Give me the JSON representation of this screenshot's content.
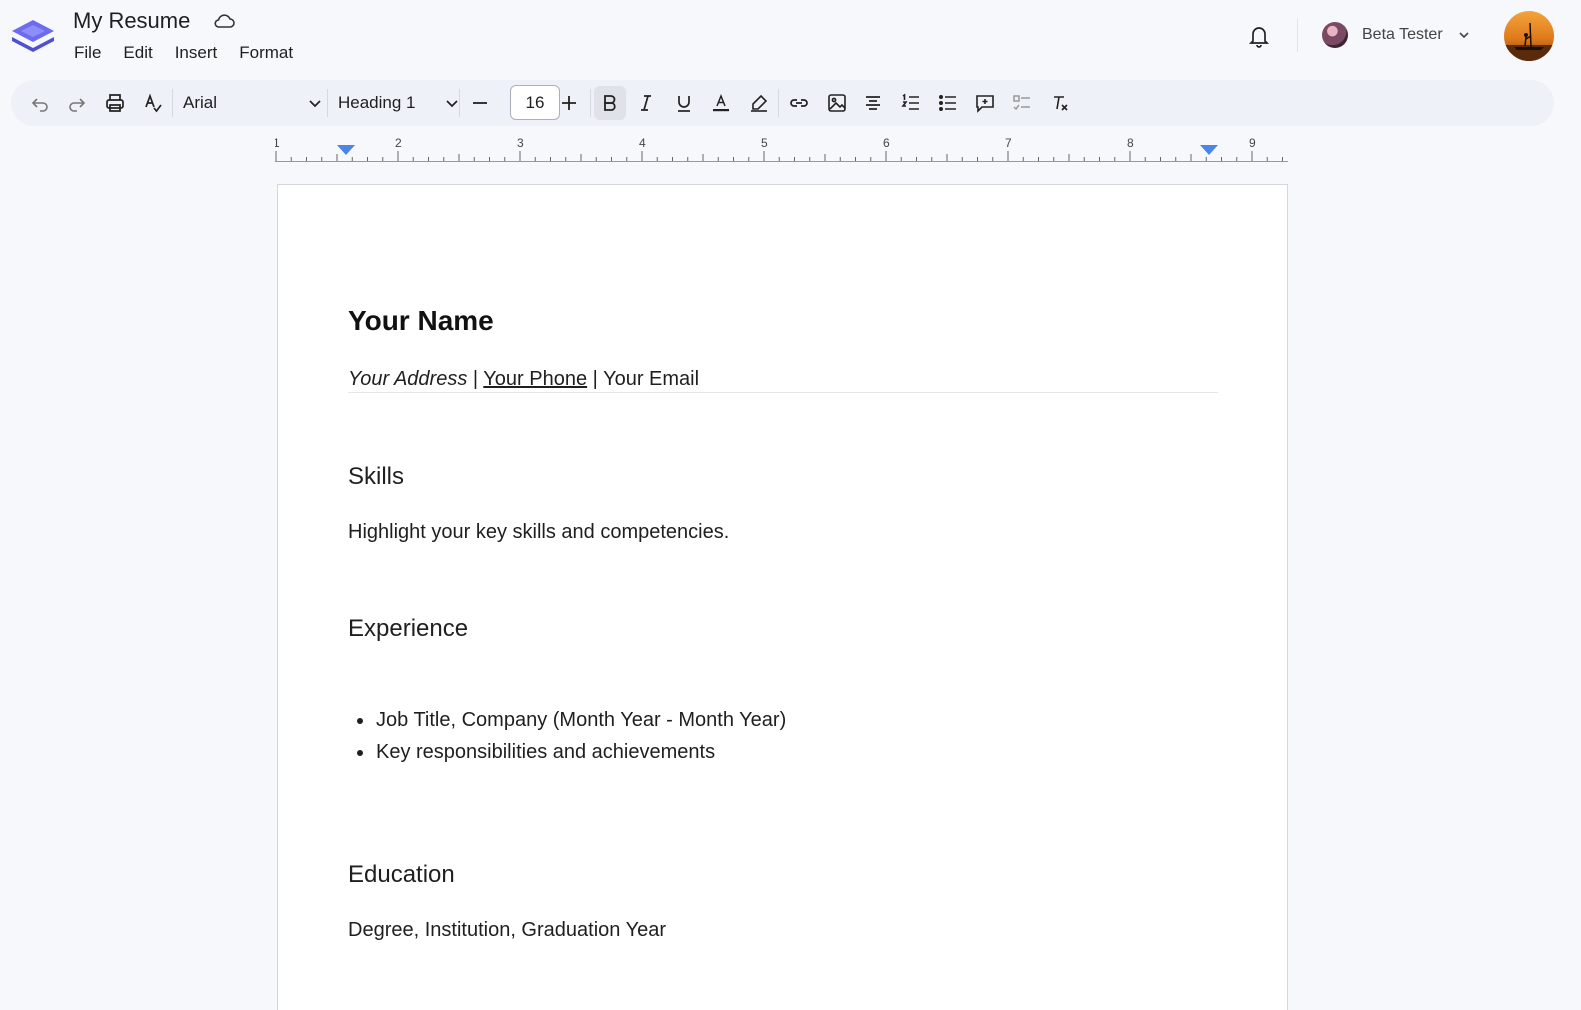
{
  "app": {
    "doc_title": "My Resume",
    "menu": [
      "File",
      "Edit",
      "Insert",
      "Format"
    ],
    "user_name": "Beta Tester",
    "accent_color": "#5b5bd6"
  },
  "toolbar": {
    "font": "Arial",
    "paragraph_style": "Heading 1",
    "font_size": "16"
  },
  "ruler": {
    "labels": [
      "1",
      "2",
      "3",
      "4",
      "5",
      "6",
      "7",
      "8",
      "9"
    ],
    "marker_color": "#4a86e8"
  },
  "document": {
    "name": "Your Name",
    "contact": {
      "address": "Your Address",
      "separator": "|",
      "phone": "Your Phone",
      "email": "Your Email"
    },
    "skills_heading": "Skills",
    "skills_text": "Highlight your key skills and competencies.",
    "experience_heading": "Experience",
    "experience_items": [
      "Job Title, Company (Month Year - Month Year)",
      "Key responsibilities and achievements"
    ],
    "education_heading": "Education",
    "education_text": "Degree, Institution, Graduation Year"
  }
}
